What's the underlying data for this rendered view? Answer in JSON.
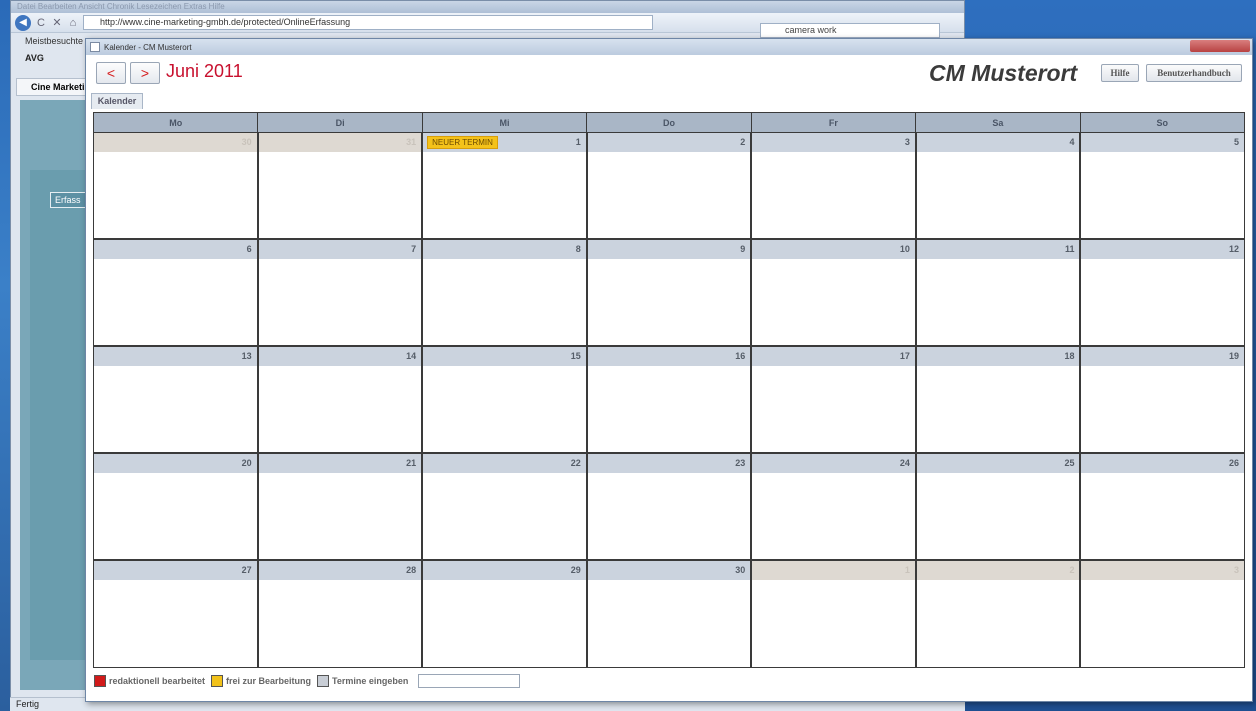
{
  "browser": {
    "menu_text": "Datei  Bearbeiten  Ansicht  Chronik  Lesezeichen  Extras  Hilfe",
    "url": "http://www.cine-marketing-gmbh.de/protected/OnlineErfassung",
    "search_value": "camera work",
    "bookmarks_label": "Meistbesuchte",
    "avg_label": "AVG",
    "tab_label": "Cine Marketi",
    "page_button": "Erfass",
    "status": "Fertig"
  },
  "popup": {
    "window_title": "Kalender - CM Musterort",
    "prev_label": "<",
    "next_label": ">",
    "month_title": "Juni 2011",
    "brand": "CM Musterort",
    "help_label": "Hilfe",
    "manual_label": "Benutzerhandbuch",
    "tab_label": "Kalender"
  },
  "calendar": {
    "weekdays": [
      "Mo",
      "Di",
      "Mi",
      "Do",
      "Fr",
      "Sa",
      "So"
    ],
    "weeks": [
      [
        {
          "d": "30",
          "other": true
        },
        {
          "d": "31",
          "other": true
        },
        {
          "d": "1",
          "event": "NEUER TERMIN"
        },
        {
          "d": "2"
        },
        {
          "d": "3"
        },
        {
          "d": "4"
        },
        {
          "d": "5"
        }
      ],
      [
        {
          "d": "6"
        },
        {
          "d": "7"
        },
        {
          "d": "8"
        },
        {
          "d": "9"
        },
        {
          "d": "10"
        },
        {
          "d": "11"
        },
        {
          "d": "12"
        }
      ],
      [
        {
          "d": "13"
        },
        {
          "d": "14"
        },
        {
          "d": "15"
        },
        {
          "d": "16"
        },
        {
          "d": "17"
        },
        {
          "d": "18"
        },
        {
          "d": "19"
        }
      ],
      [
        {
          "d": "20"
        },
        {
          "d": "21"
        },
        {
          "d": "22"
        },
        {
          "d": "23"
        },
        {
          "d": "24"
        },
        {
          "d": "25"
        },
        {
          "d": "26"
        }
      ],
      [
        {
          "d": "27"
        },
        {
          "d": "28"
        },
        {
          "d": "29"
        },
        {
          "d": "30"
        },
        {
          "d": "1",
          "other": true
        },
        {
          "d": "2",
          "other": true
        },
        {
          "d": "3",
          "other": true
        }
      ]
    ]
  },
  "legend": {
    "items": [
      {
        "label": "redaktionell bearbeitet",
        "color": "#d11a1a"
      },
      {
        "label": "frei zur Bearbeitung",
        "color": "#f2c21a"
      },
      {
        "label": "Termine eingeben",
        "color": "#c9ced6"
      }
    ],
    "input_value": ""
  }
}
